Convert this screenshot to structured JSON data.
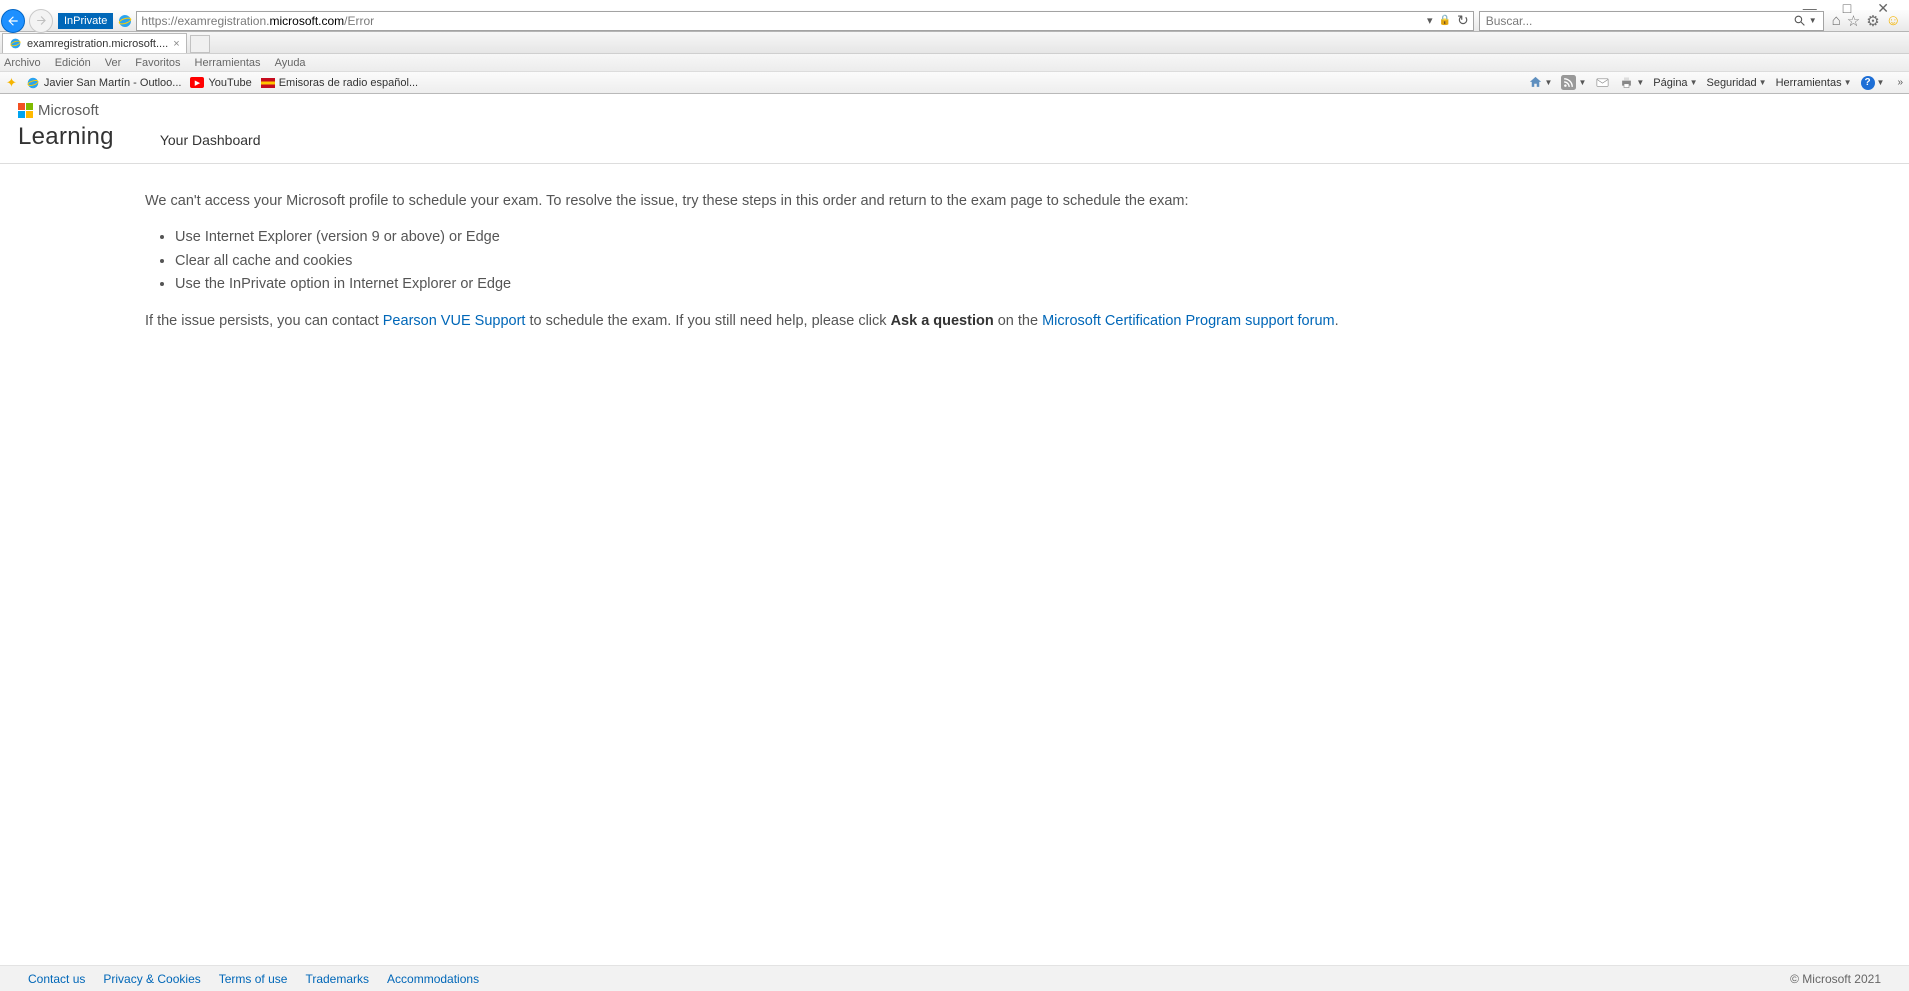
{
  "window": {
    "min": "—",
    "max": "□",
    "close": "✕"
  },
  "nav": {
    "inprivate": "InPrivate",
    "url_prefix": "https://examregistration.",
    "url_domain": "microsoft.com",
    "url_suffix": "/Error",
    "dropdown": "▾",
    "lock": "🔒",
    "refresh": "↻",
    "search_placeholder": "Buscar..."
  },
  "tabs": {
    "title": "examregistration.microsoft....",
    "close": "×"
  },
  "menus": [
    "Archivo",
    "Edición",
    "Ver",
    "Favoritos",
    "Herramientas",
    "Ayuda"
  ],
  "favbar": {
    "items": [
      {
        "label": "Javier San Martín - Outloo..."
      },
      {
        "label": "YouTube"
      },
      {
        "label": "Emisoras de radio español..."
      }
    ],
    "cmds": {
      "pagina": "Página",
      "seguridad": "Seguridad",
      "herramientas": "Herramientas"
    }
  },
  "page": {
    "microsoft": "Microsoft",
    "learning": "Learning",
    "dashboard": "Your Dashboard",
    "intro": "We can't access your Microsoft profile to schedule your exam. To resolve the issue, try these steps in this order and return to the exam page to schedule the exam:",
    "bullets": [
      "Use Internet Explorer (version 9 or above) or Edge",
      "Clear all cache and cookies",
      "Use the InPrivate option in Internet Explorer or Edge"
    ],
    "persist1": "If the issue persists, you can contact ",
    "link1": "Pearson VUE Support",
    "persist2": " to schedule the exam. If you still need help, please click ",
    "bold": "Ask a question",
    "persist3": " on the ",
    "link2": "Microsoft Certification Program support forum",
    "period": "."
  },
  "footer": {
    "links": [
      "Contact us",
      "Privacy & Cookies",
      "Terms of use",
      "Trademarks",
      "Accommodations"
    ],
    "copy": "© Microsoft 2021"
  }
}
